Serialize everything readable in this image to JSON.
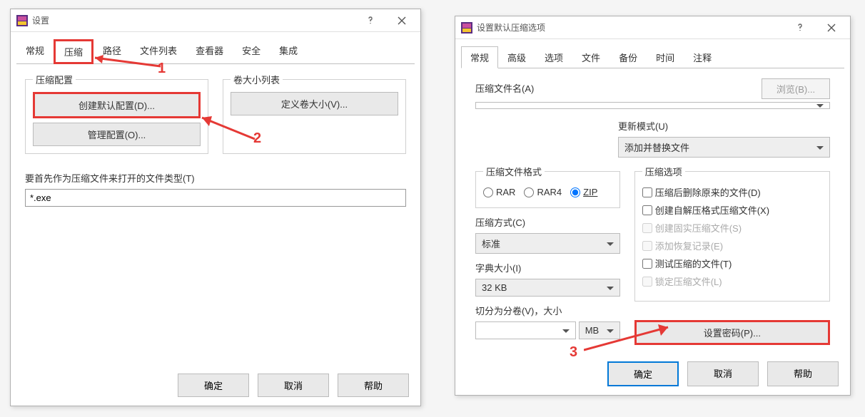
{
  "dialog1": {
    "title": "设置",
    "tabs": [
      "常规",
      "压缩",
      "路径",
      "文件列表",
      "查看器",
      "安全",
      "集成"
    ],
    "active_tab": 1,
    "group_compress_cfg": "压缩配置",
    "btn_create_default": "创建默认配置(D)...",
    "btn_manage": "管理配置(O)...",
    "group_volume": "卷大小列表",
    "btn_define_volume": "定义卷大小(V)...",
    "label_filetypes": "要首先作为压缩文件来打开的文件类型(T)",
    "val_filetypes": "*.exe",
    "ok": "确定",
    "cancel": "取消",
    "help": "帮助",
    "annot1": "1",
    "annot2": "2"
  },
  "dialog2": {
    "title": "设置默认压缩选项",
    "tabs": [
      "常规",
      "高级",
      "选项",
      "文件",
      "备份",
      "时间",
      "注释"
    ],
    "active_tab": 0,
    "label_archive_name": "压缩文件名(A)",
    "btn_browse": "浏览(B)...",
    "label_update_mode": "更新模式(U)",
    "val_update_mode": "添加并替换文件",
    "group_format": "压缩文件格式",
    "fmt_rar": "RAR",
    "fmt_rar4": "RAR4",
    "fmt_zip": "ZIP",
    "label_method": "压缩方式(C)",
    "val_method": "标准",
    "label_dict": "字典大小(I)",
    "val_dict": "32 KB",
    "label_split": "切分为分卷(V)，大小",
    "val_split_unit": "MB",
    "group_options": "压缩选项",
    "opt_delete": "压缩后删除原来的文件(D)",
    "opt_sfx": "创建自解压格式压缩文件(X)",
    "opt_solid": "创建固实压缩文件(S)",
    "opt_recovery": "添加恢复记录(E)",
    "opt_test": "测试压缩的文件(T)",
    "opt_lock": "锁定压缩文件(L)",
    "btn_password": "设置密码(P)...",
    "ok": "确定",
    "cancel": "取消",
    "help": "帮助",
    "annot3": "3"
  }
}
